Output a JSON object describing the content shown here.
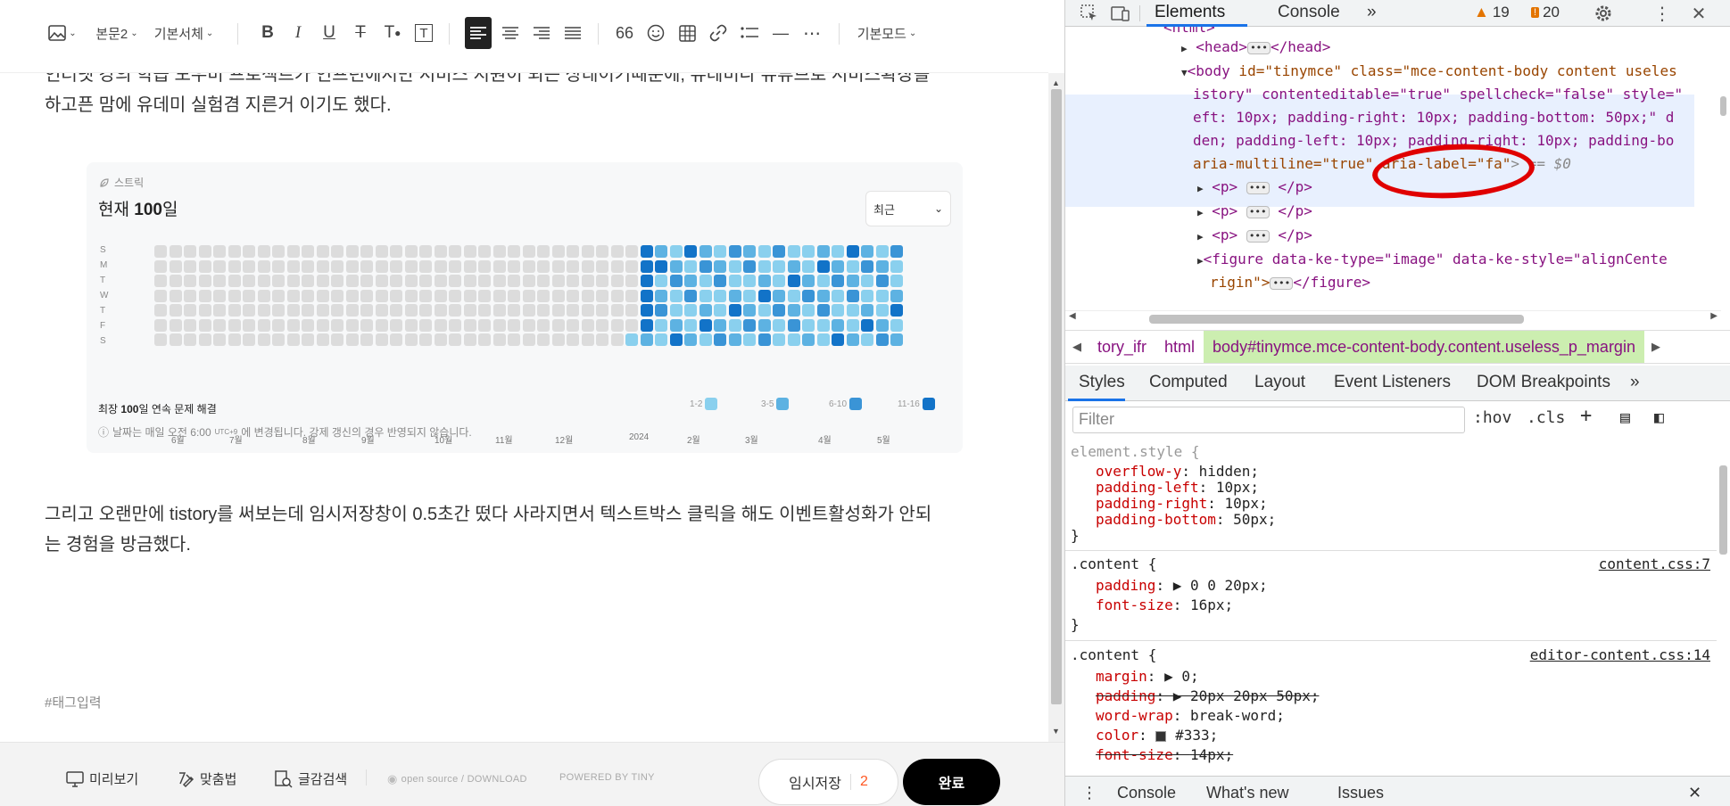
{
  "toolbar": {
    "paragraph_style": "본문2",
    "font_family": "기본서체",
    "mode": "기본모드",
    "bold": "B",
    "italic": "I",
    "underline": "U",
    "strike": "T",
    "color": "T",
    "bg": "T",
    "quote": "66",
    "hr": "—",
    "more": "⋯"
  },
  "content": {
    "para1_line1": "인터넷 강의 학습 도우미 프로젝트가 인프런에서만 서비스 지원이 되는 상태이기때문에, 유데미나 유튜브로 서비스확장을",
    "para1_line2": "하고픈 맘에 유데미 실험겸 지른거 이기도 했다.",
    "para2_line1": "그리고 오랜만에 tistory를 써보는데 임시저장창이 0.5초간 떴다 사라지면서 텍스트박스 클릭을 해도 이벤트활성화가 안되",
    "para2_line2": "는 경험을 방금했다.",
    "tag_placeholder": "#태그입력"
  },
  "streak": {
    "label": "스트릭",
    "title_prefix": "현재 ",
    "title_value": "100",
    "title_suffix": "일",
    "select_value": "최근",
    "days": [
      "S",
      "M",
      "T",
      "W",
      "T",
      "F",
      "S"
    ],
    "months": [
      "6월",
      "7월",
      "8월",
      "9월",
      "10월",
      "11월",
      "12월",
      "2024",
      "2월",
      "3월",
      "4월",
      "5월"
    ],
    "foot_prefix": "최장 ",
    "foot_value": "100",
    "foot_suffix": "일 연속 문제 해결",
    "note_prefix": "날짜는 매일 오전 6:00",
    "note_sup": "UTC+9",
    "note_suffix": "에 변경됩니다. 강제 갱신의 경우 반영되지 않습니다.",
    "legend": [
      {
        "label": "1-2",
        "color": "#8ad0ee"
      },
      {
        "label": "3-5",
        "color": "#5db2e2"
      },
      {
        "label": "6-10",
        "color": "#3a94d6"
      },
      {
        "label": "11-16",
        "color": "#1273c8"
      }
    ],
    "colors": {
      "empty": "#dcdcdc",
      "l1": "#8ad0ee",
      "l2": "#5db2e2",
      "l3": "#3a94d6",
      "l4": "#1273c8"
    }
  },
  "bottombar": {
    "preview": "미리보기",
    "spell": "맞춤법",
    "search": "글감검색",
    "opensource": "open source / DOWNLOAD",
    "powered": "POWERED BY TINY",
    "save": "임시저장",
    "save_count": "2",
    "done": "완료"
  },
  "devtools": {
    "tabs": {
      "elements": "Elements",
      "console": "Console",
      "more": "»"
    },
    "warnings": "19",
    "errors": "20",
    "elements_lines": [
      {
        "t": "<html>"
      },
      {
        "t": "<head>"
      },
      {
        "t": "</head>"
      }
    ],
    "body_open": "<body",
    "body_attrs": " id=\"tinymce\" class=\"mce-content-body content useles",
    "body_line2": "istory\" contenteditable=\"true\" spellcheck=\"false\" style=\"",
    "body_line3": "eft: 10px; padding-right: 10px; padding-bottom: 50px;\" d",
    "body_line4": "den; padding-left: 10px; padding-right: 10px; padding-bo",
    "body_line5a": "aria-multiline=\"true\" ",
    "body_line5b": "aria-label=\"fa\"",
    "body_line5c": "> == $0",
    "p1": "<p>",
    "p1c": "</p>",
    "figure": "<figure data-ke-type=\"image\" data-ke-style=\"alignCente",
    "figure2": "rigin\">",
    "figure2c": "</figure>",
    "head_open": "<head>",
    "head_close": "</head>",
    "html_text": "<html>",
    "crumbs": [
      "tory_ifr",
      "html",
      "body#tinymce.mce-content-body.content.useless_p_margin"
    ],
    "styletabs": [
      "Styles",
      "Computed",
      "Layout",
      "Event Listeners",
      "DOM Breakpoints",
      "»"
    ],
    "filter_placeholder": "Filter",
    "hov": ":hov",
    "cls": ".cls",
    "rule1_sel": "element.style {",
    "rule1_props": [
      [
        "overflow-y",
        "hidden;"
      ],
      [
        "padding-left",
        "10px;"
      ],
      [
        "padding-right",
        "10px;"
      ],
      [
        "padding-bottom",
        "50px;"
      ]
    ],
    "rule2_sel": ".content {",
    "rule2_src": "content.css:7",
    "rule2_props": [
      [
        "padding",
        "▶ 0 0 20px;"
      ],
      [
        "font-size",
        "16px;"
      ]
    ],
    "rule3_sel": ".content {",
    "rule3_src": "editor-content.css:14",
    "rule3_props": [
      [
        "margin",
        "▶ 0;"
      ],
      [
        "padding",
        "▶ 20px 20px 50px;"
      ],
      [
        "word-wrap",
        "break-word;"
      ],
      [
        "color",
        "#333;"
      ],
      [
        "font-size",
        "14px;"
      ]
    ],
    "close_brace": "}",
    "drawer": {
      "console": "Console",
      "whatsnew": "What's new",
      "issues": "Issues"
    }
  }
}
